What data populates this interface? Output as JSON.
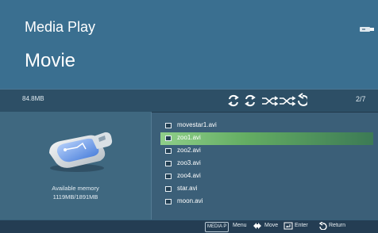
{
  "app": {
    "title": "Media Play"
  },
  "page": {
    "title": "Movie"
  },
  "status": {
    "size": "84.8MB",
    "page": "2/7"
  },
  "memory": {
    "label": "Available memory",
    "value": "1119MB/1891MB"
  },
  "files": [
    {
      "name": "movestar1.avi"
    },
    {
      "name": "zoo1.avi"
    },
    {
      "name": "zoo2.avi"
    },
    {
      "name": "zoo3.avi"
    },
    {
      "name": "zoo4.avi"
    },
    {
      "name": "star.avi"
    },
    {
      "name": "moon.avi"
    }
  ],
  "selected_index": 1,
  "footer": {
    "menu_badge": "MEDIA P",
    "menu": "Menu",
    "move": "Move",
    "enter": "Enter",
    "return": "Return"
  },
  "icons": {
    "top_right": "usb-icon",
    "playback_modes": [
      "repeat-all-icon",
      "repeat-one-icon",
      "shuffle-icon",
      "shuffle-off-icon",
      "reverse-icon"
    ]
  }
}
